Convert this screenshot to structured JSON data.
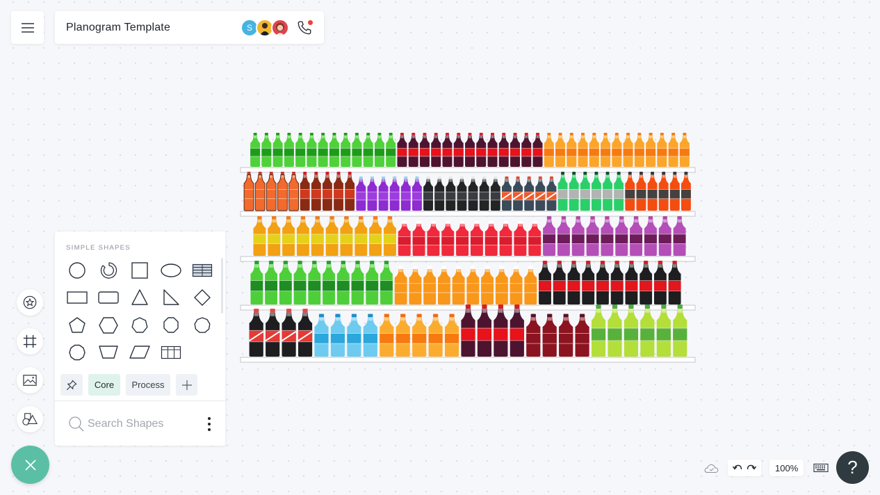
{
  "header": {
    "menu_icon": "hamburger-icon",
    "title": "Planogram Template",
    "avatars": [
      {
        "initial": "S",
        "color": "#47b3e1"
      },
      {
        "initial": "",
        "color": "#f2b632"
      },
      {
        "initial": "",
        "color": "#e2434b"
      }
    ],
    "call_icon": "phone-icon",
    "call_status_color": "#e8423d"
  },
  "left_toolbar": {
    "items": [
      {
        "name": "favorites",
        "icon": "star-sticker-icon"
      },
      {
        "name": "frames",
        "icon": "frame-grid-icon"
      },
      {
        "name": "images",
        "icon": "image-icon"
      },
      {
        "name": "shapes",
        "icon": "shapes-icon"
      }
    ],
    "close_icon": "close-icon",
    "close_color": "#5bbfa6"
  },
  "shapes_panel": {
    "heading": "SIMPLE SHAPES",
    "shapes": [
      "circle",
      "ring",
      "square",
      "ellipse",
      "table-striped",
      "rectangle",
      "rounded-rectangle",
      "triangle",
      "right-triangle",
      "diamond",
      "pentagon",
      "hexagon",
      "heptagon",
      "octagon",
      "nonagon",
      "decagon",
      "trapezoid",
      "parallelogram",
      "table-grid"
    ],
    "tabs": [
      {
        "label": "",
        "icon": "pin-icon",
        "active": false
      },
      {
        "label": "Core",
        "active": true
      },
      {
        "label": "Process",
        "active": false
      },
      {
        "label": "",
        "icon": "plus-icon",
        "active": false
      }
    ],
    "search": {
      "placeholder": "Search Shapes",
      "value": ""
    },
    "more_icon": "more-vertical-icon"
  },
  "planogram": {
    "shelves": [
      {
        "groups": [
          {
            "product": "green-soda-bottle",
            "count": 13,
            "body": "#4fd13a",
            "label": "#1f9b1c",
            "cap": "#1f9b1c"
          },
          {
            "product": "cola-bottle",
            "count": 13,
            "body": "#4d1430",
            "label": "#e8121a",
            "cap": "#d61f26"
          },
          {
            "product": "orange-soda-bottle",
            "count": 13,
            "body": "#fba62a",
            "label": "#f77a10",
            "cap": "#f77a10"
          }
        ]
      },
      {
        "groups": [
          {
            "product": "orange-glass-bottle",
            "count": 5,
            "body": "#f36a2d",
            "label": "#f36a2d",
            "cap": "#c83a2e"
          },
          {
            "product": "brown-cola-bottle",
            "count": 5,
            "body": "#8b2a14",
            "label": "#d2391c",
            "cap": "#d01f28"
          },
          {
            "product": "purple-bottle",
            "count": 6,
            "body": "#8e2bd1",
            "label": "#9e3ce0",
            "cap": "#9bd3ea"
          },
          {
            "product": "black-glass-bottle",
            "count": 7,
            "body": "#222426",
            "label": "#3a3c3f",
            "cap": "#e8e8e8"
          },
          {
            "product": "navy-soda-bottle",
            "count": 5,
            "body": "#3b4b5a",
            "label": "#f05a2a",
            "cap": "#e34a2a"
          },
          {
            "product": "green-glass-bottle",
            "count": 6,
            "body": "#2bcf69",
            "label": "#b3b3b3",
            "cap": "#16502e"
          },
          {
            "product": "orange-dark-label-bottle",
            "count": 6,
            "body": "#f34d10",
            "label": "#454140",
            "cap": "#3a3a3a"
          }
        ]
      },
      {
        "groups": [
          {
            "product": "mango-soda-bottle",
            "count": 10,
            "body": "#f2a114",
            "label": "#e4d21a",
            "cap": "#ef7d1c"
          },
          {
            "product": "red-mini-bottle",
            "count": 10,
            "body": "#f02a3c",
            "label": "#d91c2e",
            "cap": "#ffffff"
          },
          {
            "product": "grape-soda-bottle",
            "count": 10,
            "body": "#b54fb8",
            "label": "#6d1c5a",
            "cap": "#b24aa9"
          }
        ]
      },
      {
        "groups": [
          {
            "product": "lime-soda-bottle",
            "count": 10,
            "body": "#4ecf3a",
            "label": "#1f8d24",
            "cap": "#27a132"
          },
          {
            "product": "orange-mini-bottle",
            "count": 10,
            "body": "#f9971a",
            "label": "#f9971a",
            "cap": "#ffffff"
          },
          {
            "product": "black-cola-bottle",
            "count": 10,
            "body": "#1e1e20",
            "label": "#e3151d",
            "cap": "#d61f26"
          }
        ]
      },
      {
        "groups": [
          {
            "product": "cola-swirl-bottle",
            "count": 4,
            "body": "#1e1e20",
            "label": "#e53a35",
            "cap": "#e8474a"
          },
          {
            "product": "blue-water-bottle",
            "count": 4,
            "body": "#6ecbf0",
            "label": "#2ba7dc",
            "cap": "#1e8fc8"
          },
          {
            "product": "orange-juice-bottle",
            "count": 5,
            "body": "#fbac2f",
            "label": "#f77a10",
            "cap": "#f36a13"
          },
          {
            "product": "large-cola-bottle",
            "count": 4,
            "body": "#4d1430",
            "label": "#e8121a",
            "cap": "#d61f26"
          },
          {
            "product": "dark-red-bottle",
            "count": 4,
            "body": "#8c1420",
            "label": "#8c1420",
            "cap": "#5a1028"
          },
          {
            "product": "lime-green-bottle",
            "count": 6,
            "body": "#b4de3a",
            "label": "#58b13c",
            "cap": "#4fa84a"
          }
        ]
      }
    ]
  },
  "bottom_bar": {
    "save_status_icon": "cloud-saved-icon",
    "undo_icon": "undo-icon",
    "redo_icon": "redo-icon",
    "zoom": "100%",
    "keyboard_icon": "keyboard-icon",
    "help_label": "?"
  }
}
